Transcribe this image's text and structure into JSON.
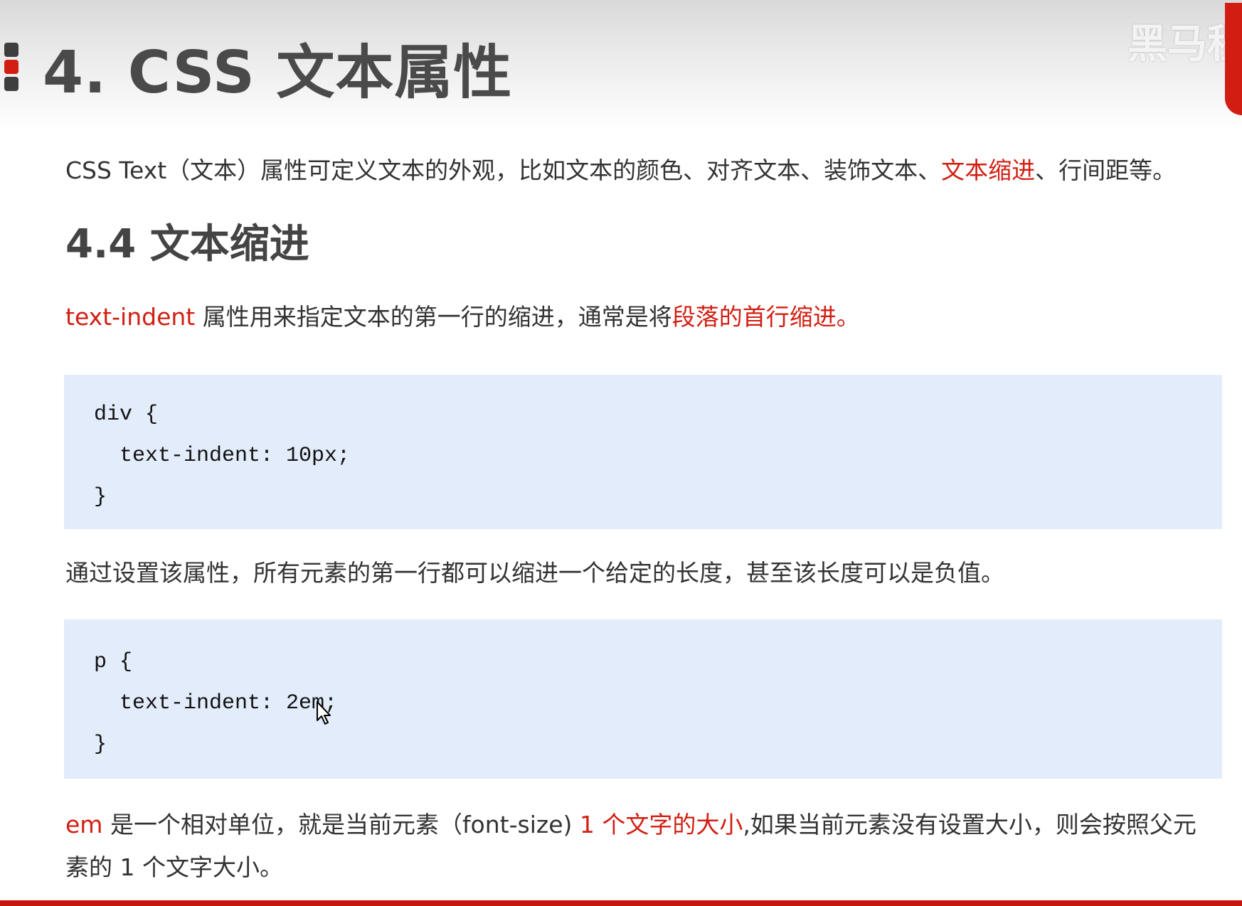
{
  "header": {
    "title": "4. CSS 文本属性",
    "logo_text": "黑马程序"
  },
  "intro": {
    "before": "CSS Text（文本）属性可定义文本的外观，比如文本的颜色、对齐文本、装饰文本、",
    "highlight": "文本缩进",
    "after": "、行间距等。"
  },
  "section": {
    "heading": "4.4 文本缩进"
  },
  "desc": {
    "prop": "text-indent",
    "middle": " 属性用来指定文本的第一行的缩进，通常是将",
    "highlight": "段落的首行缩进。"
  },
  "code1": {
    "line1": "div {",
    "line2": "  text-indent: 10px;",
    "line3": "}"
  },
  "note": {
    "text": "通过设置该属性，所有元素的第一行都可以缩进一个给定的长度，甚至该长度可以是负值。"
  },
  "code2": {
    "line1": "p {",
    "line2": "  text-indent: 2em;",
    "line3": "}"
  },
  "em_note": {
    "em": "em",
    "part1": " 是一个相对单位，就是当前元素（font-size) ",
    "highlight": "1 个文字的大小",
    "part2": ",如果当前元素没有设置大小，则会按照父元",
    "line2": "素的 1 个文字大小。"
  },
  "colors": {
    "accent_red": "#d21e12",
    "code_bg": "#e3ecfb",
    "title_gray": "#4a4a4a"
  }
}
